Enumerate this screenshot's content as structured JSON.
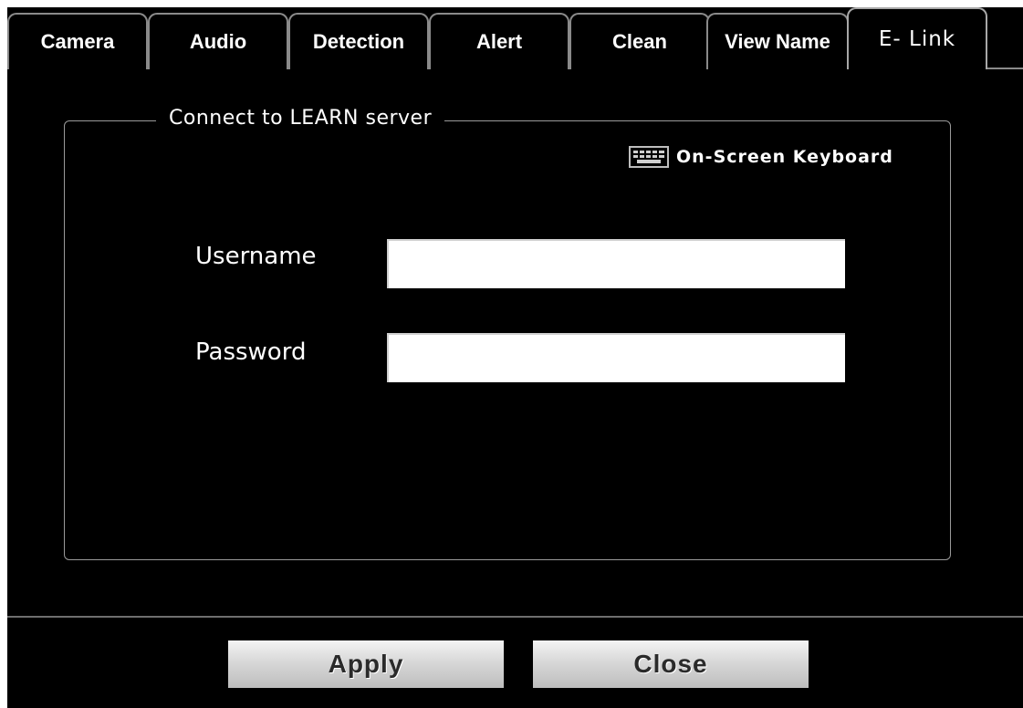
{
  "tabs": [
    {
      "label": "Camera"
    },
    {
      "label": "Audio"
    },
    {
      "label": "Detection"
    },
    {
      "label": "Alert"
    },
    {
      "label": "Clean"
    },
    {
      "label": "View Name"
    },
    {
      "label": "E- Link"
    }
  ],
  "active_tab": "E- Link",
  "group": {
    "title": "Connect to LEARN server"
  },
  "keyboard": {
    "label": "On-Screen Keyboard",
    "icon": "keyboard-icon"
  },
  "form": {
    "username_label": "Username",
    "username_value": "",
    "password_label": "Password",
    "password_value": ""
  },
  "buttons": {
    "apply_label": "Apply",
    "close_label": "Close"
  },
  "colors": {
    "background": "#000000",
    "text": "#ffffff",
    "tab_border": "#8a8a8a",
    "input_bg": "#ffffff"
  }
}
